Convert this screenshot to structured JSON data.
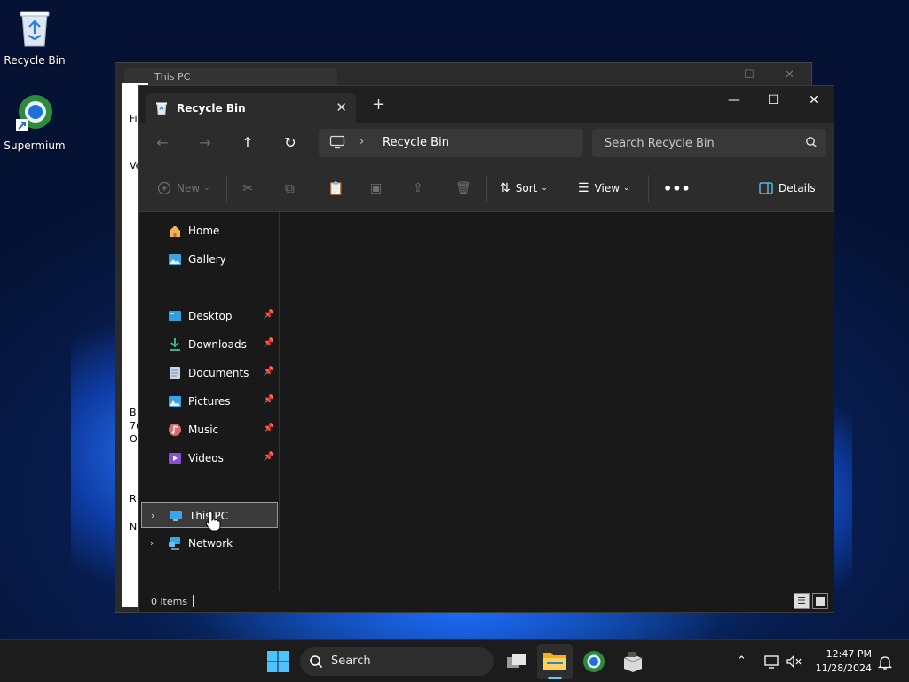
{
  "desktop": {
    "icons": [
      {
        "label": "Recycle Bin"
      },
      {
        "label": "Supermium"
      }
    ]
  },
  "background_window": {
    "tab_label": "This PC",
    "side_texts": [
      "Fi",
      "Ve",
      "B",
      "7(",
      "O",
      "R",
      "N"
    ]
  },
  "window": {
    "tab_title": "Recycle Bin",
    "address_path": "Recycle Bin",
    "search_placeholder": "Search Recycle Bin",
    "toolbar": {
      "new_label": "New",
      "sort_label": "Sort",
      "view_label": "View",
      "details_label": "Details"
    },
    "nav": {
      "quick": [
        {
          "label": "Home",
          "icon": "home-icon"
        },
        {
          "label": "Gallery",
          "icon": "gallery-icon"
        }
      ],
      "pinned": [
        {
          "label": "Desktop",
          "icon": "desktop-folder-icon"
        },
        {
          "label": "Downloads",
          "icon": "downloads-icon"
        },
        {
          "label": "Documents",
          "icon": "documents-icon"
        },
        {
          "label": "Pictures",
          "icon": "pictures-icon"
        },
        {
          "label": "Music",
          "icon": "music-icon"
        },
        {
          "label": "Videos",
          "icon": "videos-icon"
        }
      ],
      "locations": [
        {
          "label": "This PC",
          "icon": "this-pc-icon",
          "selected": true
        },
        {
          "label": "Network",
          "icon": "network-icon"
        }
      ]
    },
    "status": {
      "items_count": "0 items"
    }
  },
  "taskbar": {
    "search_label": "Search",
    "time": "12:47 PM",
    "date": "11/28/2024"
  },
  "colors": {
    "accent": "#60cdff",
    "window_bg": "#191919",
    "chrome_bg": "#2c2c2c"
  }
}
